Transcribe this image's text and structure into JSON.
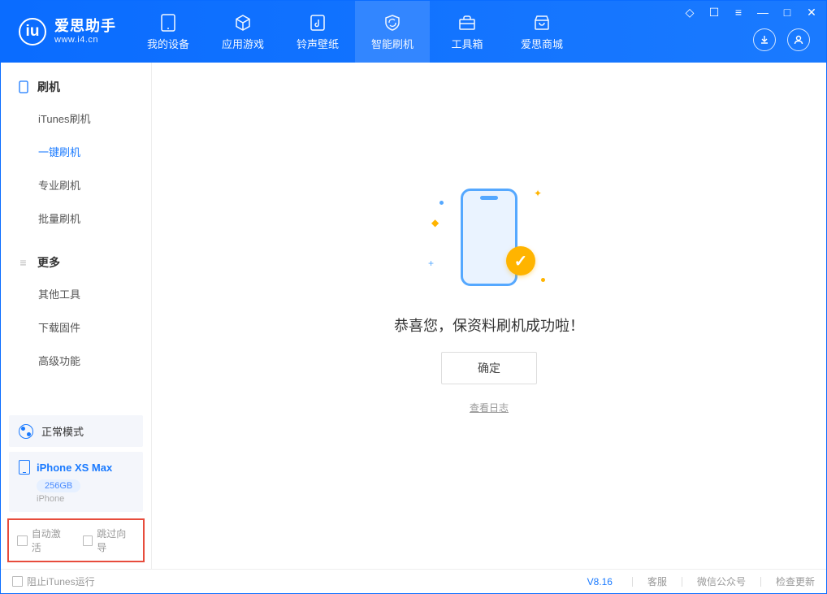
{
  "app": {
    "name": "爱思助手",
    "url": "www.i4.cn"
  },
  "nav": {
    "items": [
      {
        "label": "我的设备"
      },
      {
        "label": "应用游戏"
      },
      {
        "label": "铃声壁纸"
      },
      {
        "label": "智能刷机"
      },
      {
        "label": "工具箱"
      },
      {
        "label": "爱思商城"
      }
    ]
  },
  "sidebar": {
    "section1_title": "刷机",
    "section1_items": [
      "iTunes刷机",
      "一键刷机",
      "专业刷机",
      "批量刷机"
    ],
    "section2_title": "更多",
    "section2_items": [
      "其他工具",
      "下载固件",
      "高级功能"
    ]
  },
  "status": {
    "mode": "正常模式"
  },
  "device": {
    "name": "iPhone XS Max",
    "storage": "256GB",
    "type": "iPhone"
  },
  "options": {
    "auto_activate": "自动激活",
    "skip_guide": "跳过向导"
  },
  "main": {
    "success_text": "恭喜您，保资料刷机成功啦！",
    "confirm": "确定",
    "view_log": "查看日志"
  },
  "footer": {
    "block_itunes": "阻止iTunes运行",
    "version": "V8.16",
    "support": "客服",
    "wechat": "微信公众号",
    "check_update": "检查更新"
  }
}
